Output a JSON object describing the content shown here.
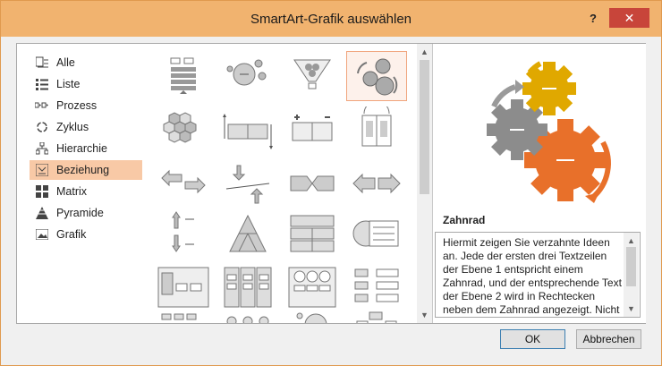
{
  "window": {
    "title": "SmartArt-Grafik auswählen",
    "help": "?",
    "close": "✕"
  },
  "categories": [
    {
      "label": "Alle",
      "icon": "all-icon"
    },
    {
      "label": "Liste",
      "icon": "list-icon"
    },
    {
      "label": "Prozess",
      "icon": "process-icon"
    },
    {
      "label": "Zyklus",
      "icon": "cycle-icon"
    },
    {
      "label": "Hierarchie",
      "icon": "hierarchy-icon"
    },
    {
      "label": "Beziehung",
      "icon": "relationship-icon",
      "selected": true
    },
    {
      "label": "Matrix",
      "icon": "matrix-icon"
    },
    {
      "label": "Pyramide",
      "icon": "pyramid-icon"
    },
    {
      "label": "Grafik",
      "icon": "picture-icon"
    }
  ],
  "preview": {
    "name": "Zahnrad",
    "description": "Hiermit zeigen Sie verzahnte Ideen an. Jede der ersten drei Textzeilen der Ebene 1 entspricht einem Zahnrad, und der entsprechende Text der Ebene 2 wird in Rechtecken neben dem Zahnrad angezeigt. Nicht verwendeter Text wird nicht",
    "colors": {
      "gold": "#e0a800",
      "gray": "#8c8c8c",
      "orange": "#e8702a"
    }
  },
  "buttons": {
    "ok": "OK",
    "cancel": "Abbrechen"
  },
  "colors": {
    "titlebar": "#f1b36f",
    "selection": "#f8c9a6",
    "close": "#c8453a"
  }
}
